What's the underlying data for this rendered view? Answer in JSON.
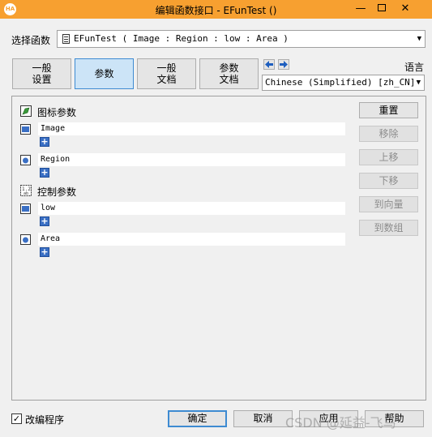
{
  "window": {
    "title": "编辑函数接口 - EFunTest ()",
    "app_icon": "HA",
    "controls": {
      "minimize": "—",
      "close": "✕"
    }
  },
  "function_select": {
    "label": "选择函数",
    "value": "EFunTest ( Image : Region : low : Area )"
  },
  "tabs": [
    {
      "label": "一般\n设置"
    },
    {
      "label": "参数"
    },
    {
      "label": "一般\n文档"
    },
    {
      "label": "参数\n文档"
    }
  ],
  "active_tab": "参数",
  "language": {
    "label": "语言",
    "value": "Chinese (Simplified) [zh_CN]"
  },
  "groups": {
    "icon_params": {
      "label": "图标参数"
    },
    "control_params": {
      "label": "控制参数"
    }
  },
  "params": [
    {
      "name": "Image",
      "kind": "input"
    },
    {
      "name": "Region",
      "kind": "output"
    },
    {
      "name": "low",
      "kind": "input"
    },
    {
      "name": "Area",
      "kind": "output"
    }
  ],
  "side_buttons": {
    "reset": "重置",
    "remove": "移除",
    "move_up": "上移",
    "move_down": "下移",
    "to_vector": "到向量",
    "to_tuple": "到数组"
  },
  "footer": {
    "edit_program_label": "改编程序",
    "edit_program_checked": "✓",
    "ok": "确定",
    "cancel": "取消",
    "apply": "应用",
    "help": "帮助"
  },
  "watermark": "CSDN @延益-飞鸟",
  "colors": {
    "titlebar": "#f7a030",
    "active_tab": "#cce4f7",
    "accent_border": "#3e8bd2"
  }
}
